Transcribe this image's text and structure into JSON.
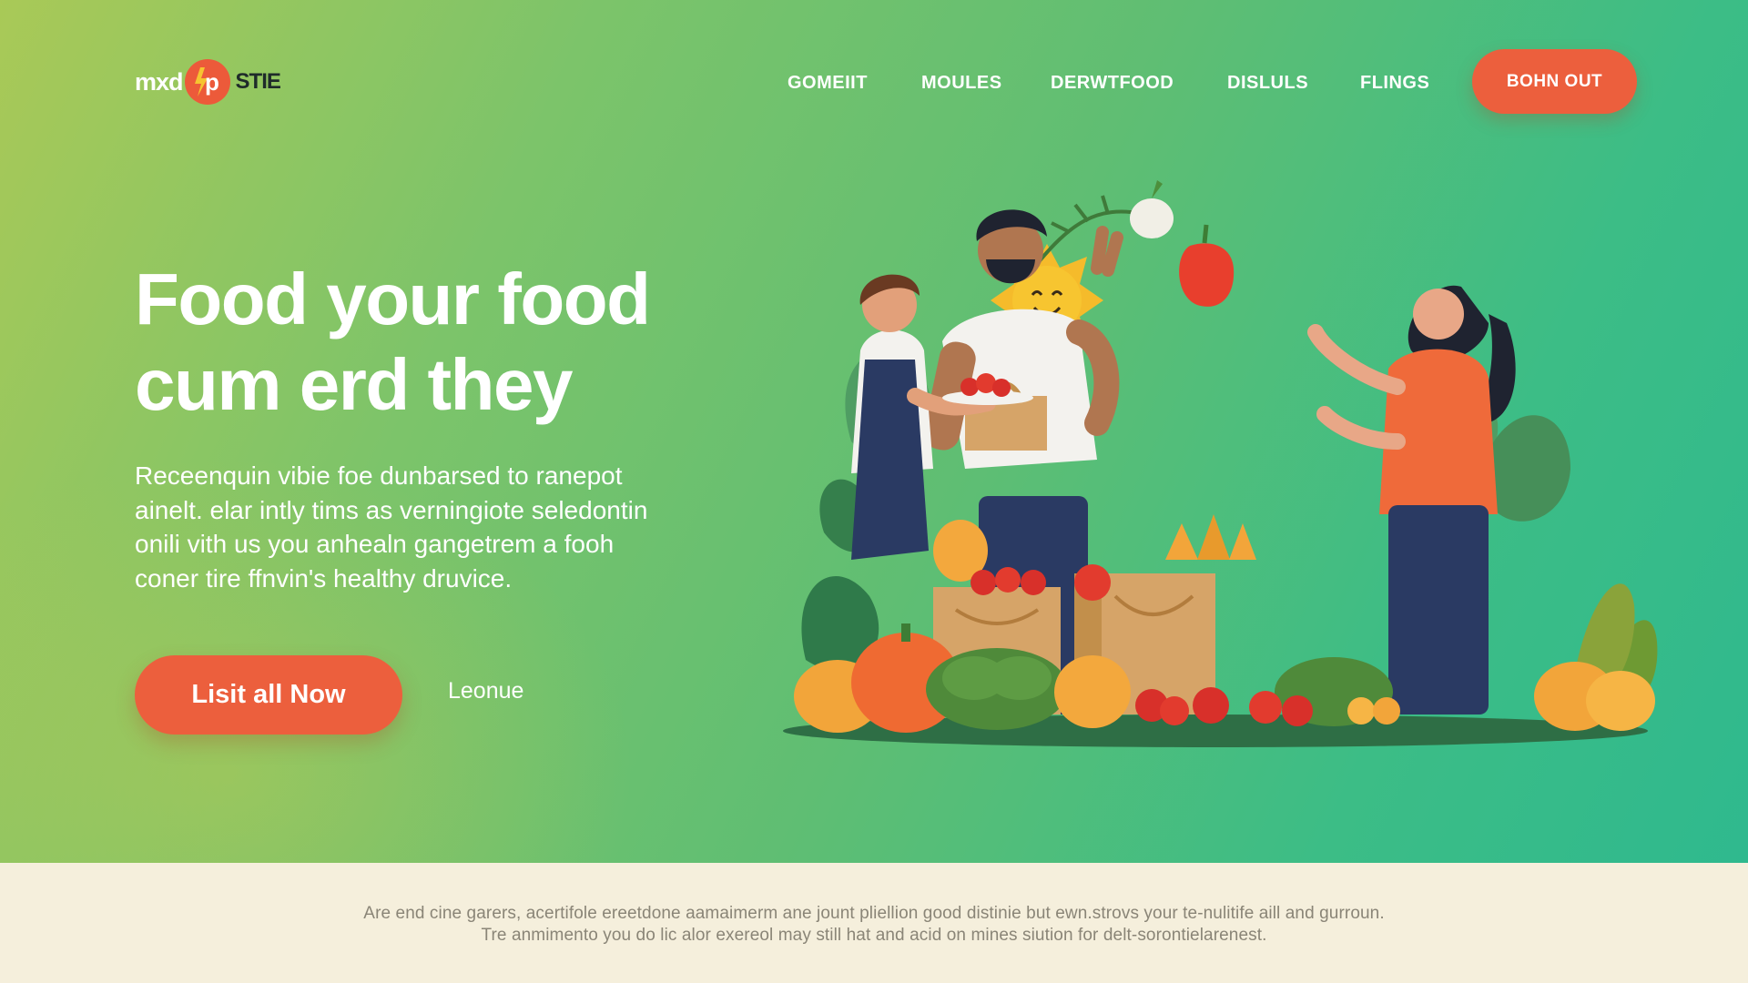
{
  "header": {
    "logo": {
      "left_text": "mxd",
      "badge_letter": "p",
      "right_text": "STIE"
    },
    "nav": [
      {
        "label": "GOMEIIT"
      },
      {
        "label": "MOULES"
      },
      {
        "label": "DERWTFOOD"
      },
      {
        "label": "DISLULS"
      },
      {
        "label": "FLINGS"
      }
    ],
    "cta_label": "BOHN OUT"
  },
  "hero": {
    "headline_lines": [
      "Food your food",
      "cum erd they"
    ],
    "subtext_lines": [
      "Receenquin vibie foe dunbarsed to ranepot",
      "ainelt. elar intly tims as verningiote seledontin",
      "onili vith us you anhealn gangetrem a fooh",
      "coner tire ffnvin's healthy druvice."
    ],
    "primary_button": "Lisit all Now",
    "secondary_link": "Leonue"
  },
  "footer": {
    "lines": [
      "Are end cine garers, acertifole ereetdone aamaimerm ane jount pliellion good distinie but ewn.strovs your te-nulitife aill and gurroun.",
      "Tre anmimento you do lic alor exereol may still hat and acid on mines siution for delt-sorontielarenest."
    ]
  },
  "colors": {
    "accent": "#ec5f3d",
    "hero_gradient_start": "#a9c957",
    "hero_gradient_end": "#2fb98e",
    "footer_bg": "#f5efdc",
    "footer_text": "#8a8577",
    "logo_dark": "#1f2b2a"
  },
  "illustration": {
    "name": "people-sharing-fresh-produce",
    "elements": [
      "sun-smiley",
      "woman-with-tomato-plate",
      "man-holding-basket",
      "woman-reaching",
      "pumpkins",
      "cabbage",
      "tomatoes",
      "peppers",
      "paper-bags",
      "leaves",
      "radish",
      "bell-pepper"
    ]
  }
}
